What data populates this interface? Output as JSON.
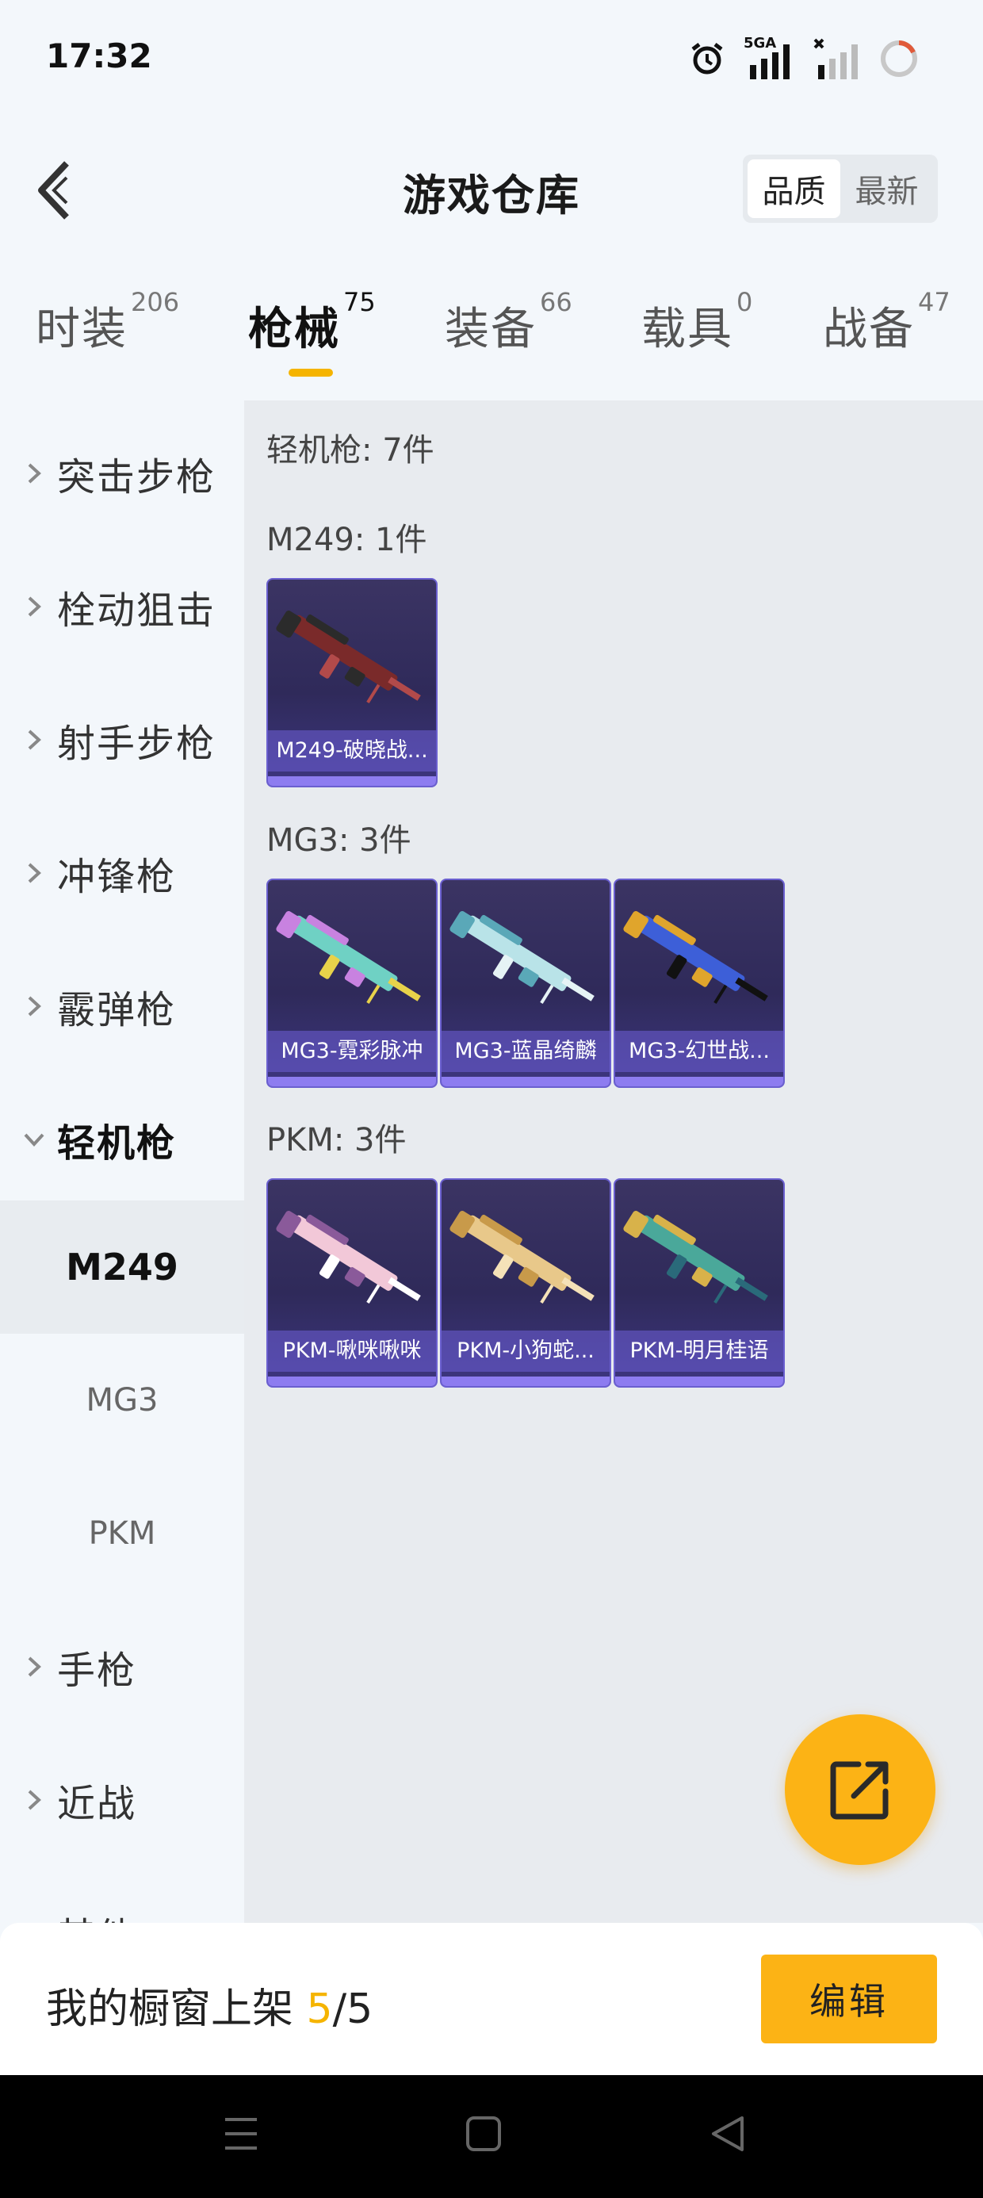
{
  "status_bar": {
    "time": "17:32",
    "network_label": "5GA"
  },
  "header": {
    "title": "游戏仓库",
    "sort_options": [
      "品质",
      "最新"
    ],
    "active_sort": "品质"
  },
  "tabs": [
    {
      "label": "时装",
      "count": "206"
    },
    {
      "label": "枪械",
      "count": "75"
    },
    {
      "label": "装备",
      "count": "66"
    },
    {
      "label": "载具",
      "count": "0"
    },
    {
      "label": "战备",
      "count": "47"
    }
  ],
  "active_tab": "枪械",
  "sidebar": {
    "items": [
      {
        "label": "突击步枪"
      },
      {
        "label": "栓动狙击"
      },
      {
        "label": "射手步枪"
      },
      {
        "label": "冲锋枪"
      },
      {
        "label": "霰弹枪"
      },
      {
        "label": "轻机枪"
      }
    ],
    "sub_items": [
      {
        "label": "M249"
      },
      {
        "label": "MG3"
      },
      {
        "label": "PKM"
      }
    ],
    "items_after": [
      {
        "label": "手枪"
      },
      {
        "label": "近战"
      },
      {
        "label": "其他"
      }
    ],
    "expanded": "轻机枪",
    "active_sub": "M249"
  },
  "content": {
    "category_summary": "轻机枪: 7件",
    "groups": [
      {
        "heading": "M249: 1件",
        "items": [
          {
            "name": "M249-破晓战...",
            "colors": [
              "#7a2a2a",
              "#2b2b2b",
              "#b24a4a"
            ]
          }
        ]
      },
      {
        "heading": "MG3: 3件",
        "items": [
          {
            "name": "MG3-霓彩脉冲",
            "colors": [
              "#6fd1c4",
              "#c882e0",
              "#e8d24a"
            ]
          },
          {
            "name": "MG3-蓝晶绮麟",
            "colors": [
              "#b9e3e8",
              "#5aa8b8",
              "#e6f3f5"
            ]
          },
          {
            "name": "MG3-幻世战...",
            "colors": [
              "#3d5fd8",
              "#e0a52c",
              "#111111"
            ]
          }
        ]
      },
      {
        "heading": "PKM: 3件",
        "items": [
          {
            "name": "PKM-啾咪啾咪",
            "colors": [
              "#f2c8d8",
              "#8a5a9a",
              "#ffffff"
            ]
          },
          {
            "name": "PKM-小狗蛇...",
            "colors": [
              "#e8c88a",
              "#c89a4a",
              "#f5e2b8"
            ]
          },
          {
            "name": "PKM-明月桂语",
            "colors": [
              "#4aa89a",
              "#d8b24a",
              "#2a6a7a"
            ]
          }
        ]
      }
    ]
  },
  "bottom_bar": {
    "showcase_label": "我的橱窗上架 ",
    "showcase_current": "5",
    "showcase_total": "/5",
    "edit_label": "编辑"
  },
  "colors": {
    "accent": "#fcb315",
    "card_border": "#6a5fcf",
    "card_bg": "#2f2a5a"
  },
  "icons": {
    "back": "chevron-left-icon",
    "share": "share-external-icon",
    "alarm": "alarm-icon",
    "signal": "signal-icon",
    "battery": "battery-ring-icon"
  }
}
